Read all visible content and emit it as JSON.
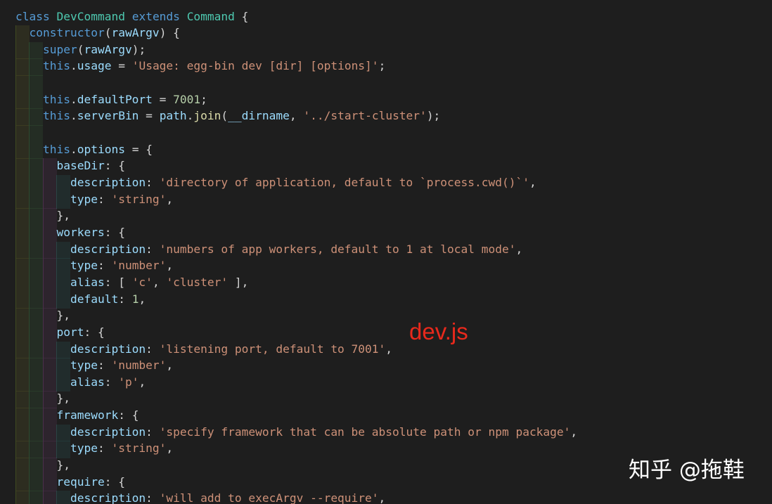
{
  "editor": {
    "lines": [
      [
        {
          "t": "class ",
          "c": "kw"
        },
        {
          "t": "DevCommand",
          "c": "cls"
        },
        {
          "t": " ",
          "c": "punc"
        },
        {
          "t": "extends",
          "c": "kw"
        },
        {
          "t": " ",
          "c": "punc"
        },
        {
          "t": "Command",
          "c": "cls"
        },
        {
          "t": " {",
          "c": "punc"
        }
      ],
      [
        {
          "t": "  ",
          "c": "punc"
        },
        {
          "t": "constructor",
          "c": "kw"
        },
        {
          "t": "(",
          "c": "punc"
        },
        {
          "t": "rawArgv",
          "c": "prop"
        },
        {
          "t": ") {",
          "c": "punc"
        }
      ],
      [
        {
          "t": "    ",
          "c": "punc"
        },
        {
          "t": "super",
          "c": "kw"
        },
        {
          "t": "(",
          "c": "punc"
        },
        {
          "t": "rawArgv",
          "c": "prop"
        },
        {
          "t": ");",
          "c": "punc"
        }
      ],
      [
        {
          "t": "    ",
          "c": "punc"
        },
        {
          "t": "this",
          "c": "kw"
        },
        {
          "t": ".",
          "c": "punc"
        },
        {
          "t": "usage",
          "c": "prop"
        },
        {
          "t": " = ",
          "c": "punc"
        },
        {
          "t": "'Usage: egg-bin dev [dir] [options]'",
          "c": "str"
        },
        {
          "t": ";",
          "c": "punc"
        }
      ],
      [],
      [
        {
          "t": "    ",
          "c": "punc"
        },
        {
          "t": "this",
          "c": "kw"
        },
        {
          "t": ".",
          "c": "punc"
        },
        {
          "t": "defaultPort",
          "c": "prop"
        },
        {
          "t": " = ",
          "c": "punc"
        },
        {
          "t": "7001",
          "c": "num"
        },
        {
          "t": ";",
          "c": "punc"
        }
      ],
      [
        {
          "t": "    ",
          "c": "punc"
        },
        {
          "t": "this",
          "c": "kw"
        },
        {
          "t": ".",
          "c": "punc"
        },
        {
          "t": "serverBin",
          "c": "prop"
        },
        {
          "t": " = ",
          "c": "punc"
        },
        {
          "t": "path",
          "c": "prop"
        },
        {
          "t": ".",
          "c": "punc"
        },
        {
          "t": "join",
          "c": "fn"
        },
        {
          "t": "(",
          "c": "punc"
        },
        {
          "t": "__dirname",
          "c": "prop"
        },
        {
          "t": ", ",
          "c": "punc"
        },
        {
          "t": "'../start-cluster'",
          "c": "str"
        },
        {
          "t": ");",
          "c": "punc"
        }
      ],
      [],
      [
        {
          "t": "    ",
          "c": "punc"
        },
        {
          "t": "this",
          "c": "kw"
        },
        {
          "t": ".",
          "c": "punc"
        },
        {
          "t": "options",
          "c": "prop"
        },
        {
          "t": " = {",
          "c": "punc"
        }
      ],
      [
        {
          "t": "      ",
          "c": "punc"
        },
        {
          "t": "baseDir",
          "c": "prop"
        },
        {
          "t": ": {",
          "c": "punc"
        }
      ],
      [
        {
          "t": "        ",
          "c": "punc"
        },
        {
          "t": "description",
          "c": "prop"
        },
        {
          "t": ": ",
          "c": "punc"
        },
        {
          "t": "'directory of application, default to `process.cwd()`'",
          "c": "str"
        },
        {
          "t": ",",
          "c": "punc"
        }
      ],
      [
        {
          "t": "        ",
          "c": "punc"
        },
        {
          "t": "type",
          "c": "prop"
        },
        {
          "t": ": ",
          "c": "punc"
        },
        {
          "t": "'string'",
          "c": "str"
        },
        {
          "t": ",",
          "c": "punc"
        }
      ],
      [
        {
          "t": "      },",
          "c": "punc"
        }
      ],
      [
        {
          "t": "      ",
          "c": "punc"
        },
        {
          "t": "workers",
          "c": "prop"
        },
        {
          "t": ": {",
          "c": "punc"
        }
      ],
      [
        {
          "t": "        ",
          "c": "punc"
        },
        {
          "t": "description",
          "c": "prop"
        },
        {
          "t": ": ",
          "c": "punc"
        },
        {
          "t": "'numbers of app workers, default to 1 at local mode'",
          "c": "str"
        },
        {
          "t": ",",
          "c": "punc"
        }
      ],
      [
        {
          "t": "        ",
          "c": "punc"
        },
        {
          "t": "type",
          "c": "prop"
        },
        {
          "t": ": ",
          "c": "punc"
        },
        {
          "t": "'number'",
          "c": "str"
        },
        {
          "t": ",",
          "c": "punc"
        }
      ],
      [
        {
          "t": "        ",
          "c": "punc"
        },
        {
          "t": "alias",
          "c": "prop"
        },
        {
          "t": ": [ ",
          "c": "punc"
        },
        {
          "t": "'c'",
          "c": "str"
        },
        {
          "t": ", ",
          "c": "punc"
        },
        {
          "t": "'cluster'",
          "c": "str"
        },
        {
          "t": " ],",
          "c": "punc"
        }
      ],
      [
        {
          "t": "        ",
          "c": "punc"
        },
        {
          "t": "default",
          "c": "prop"
        },
        {
          "t": ": ",
          "c": "punc"
        },
        {
          "t": "1",
          "c": "num"
        },
        {
          "t": ",",
          "c": "punc"
        }
      ],
      [
        {
          "t": "      },",
          "c": "punc"
        }
      ],
      [
        {
          "t": "      ",
          "c": "punc"
        },
        {
          "t": "port",
          "c": "prop"
        },
        {
          "t": ": {",
          "c": "punc"
        }
      ],
      [
        {
          "t": "        ",
          "c": "punc"
        },
        {
          "t": "description",
          "c": "prop"
        },
        {
          "t": ": ",
          "c": "punc"
        },
        {
          "t": "'listening port, default to 7001'",
          "c": "str"
        },
        {
          "t": ",",
          "c": "punc"
        }
      ],
      [
        {
          "t": "        ",
          "c": "punc"
        },
        {
          "t": "type",
          "c": "prop"
        },
        {
          "t": ": ",
          "c": "punc"
        },
        {
          "t": "'number'",
          "c": "str"
        },
        {
          "t": ",",
          "c": "punc"
        }
      ],
      [
        {
          "t": "        ",
          "c": "punc"
        },
        {
          "t": "alias",
          "c": "prop"
        },
        {
          "t": ": ",
          "c": "punc"
        },
        {
          "t": "'p'",
          "c": "str"
        },
        {
          "t": ",",
          "c": "punc"
        }
      ],
      [
        {
          "t": "      },",
          "c": "punc"
        }
      ],
      [
        {
          "t": "      ",
          "c": "punc"
        },
        {
          "t": "framework",
          "c": "prop"
        },
        {
          "t": ": {",
          "c": "punc"
        }
      ],
      [
        {
          "t": "        ",
          "c": "punc"
        },
        {
          "t": "description",
          "c": "prop"
        },
        {
          "t": ": ",
          "c": "punc"
        },
        {
          "t": "'specify framework that can be absolute path or npm package'",
          "c": "str"
        },
        {
          "t": ",",
          "c": "punc"
        }
      ],
      [
        {
          "t": "        ",
          "c": "punc"
        },
        {
          "t": "type",
          "c": "prop"
        },
        {
          "t": ": ",
          "c": "punc"
        },
        {
          "t": "'string'",
          "c": "str"
        },
        {
          "t": ",",
          "c": "punc"
        }
      ],
      [
        {
          "t": "      },",
          "c": "punc"
        }
      ],
      [
        {
          "t": "      ",
          "c": "punc"
        },
        {
          "t": "require",
          "c": "prop"
        },
        {
          "t": ": {",
          "c": "punc"
        }
      ],
      [
        {
          "t": "        ",
          "c": "punc"
        },
        {
          "t": "description",
          "c": "prop"
        },
        {
          "t": ": ",
          "c": "punc"
        },
        {
          "t": "'will add to execArgv --require'",
          "c": "str"
        },
        {
          "t": ",",
          "c": "punc"
        }
      ]
    ]
  },
  "overlay": {
    "file_label": "dev.js",
    "watermark": "知乎 @拖鞋"
  },
  "colors": {
    "keyword": "#569cd6",
    "class_name": "#4ec9b0",
    "function": "#dcdcaa",
    "property": "#9cdcfe",
    "string": "#ce9178",
    "number": "#b5cea8",
    "label_red": "#e8291c",
    "background": "#1e1e1e"
  }
}
